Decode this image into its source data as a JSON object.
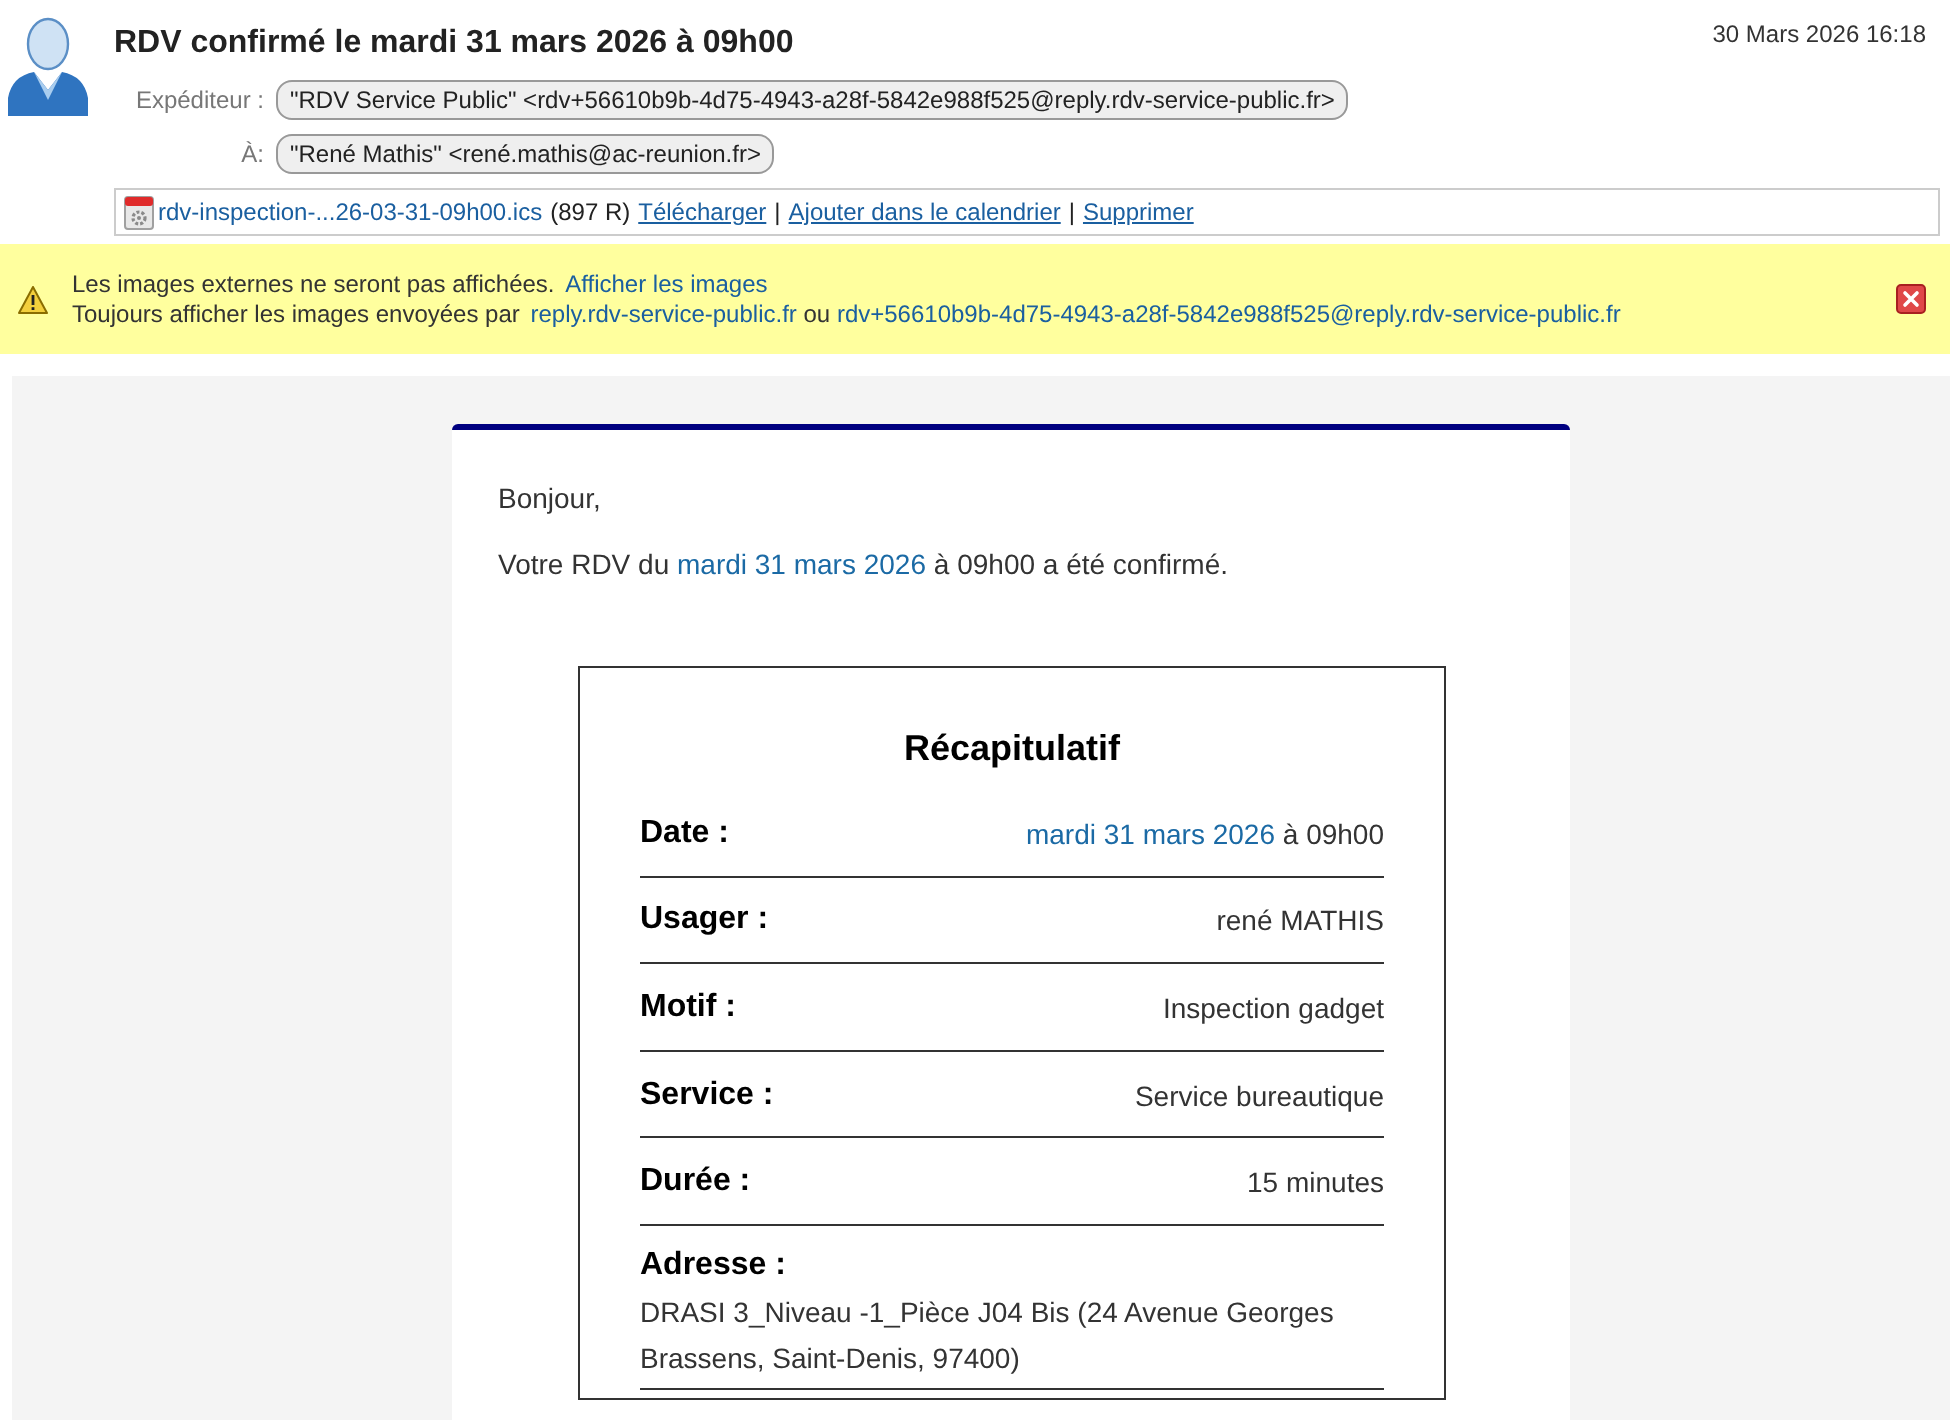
{
  "message": {
    "subject": "RDV confirmé le mardi 31 mars 2026 à 09h00",
    "date": "30 Mars 2026 16:18",
    "from": {
      "label": "Expéditeur :",
      "value": "\"RDV Service Public\" <rdv+56610b9b-4d75-4943-a28f-5842e988f525@reply.rdv-service-public.fr>"
    },
    "to": {
      "label": "À:",
      "value": "\"René Mathis\" <rené.mathis@ac-reunion.fr>"
    }
  },
  "attachment": {
    "filename": "rdv-inspection-...26-03-31-09h00.ics",
    "size": "(897 R)",
    "separator": "|",
    "actions": [
      "Télécharger",
      "Ajouter dans le calendrier",
      "Supprimer"
    ]
  },
  "notice": {
    "text": "Les images externes ne seront pas affichées.",
    "show_link": "Afficher les images",
    "always_text": "Toujours afficher les images envoyées par",
    "senders": [
      "reply.rdv-service-public.fr",
      "rdv+56610b9b-4d75-4943-a28f-5842e988f525@reply.rdv-service-public.fr"
    ],
    "conjunction": "ou"
  },
  "email_body": {
    "greeting": "Bonjour,",
    "confirmation": {
      "before": "Votre RDV du",
      "link": "mardi 31 mars 2026",
      "after": "à 09h00 a été confirmé."
    },
    "summary": {
      "title": "Récapitulatif",
      "rows": [
        {
          "kind": "inline",
          "label": "Date :",
          "link": "mardi 31 mars 2026",
          "value": "à 09h00"
        },
        {
          "kind": "inline",
          "label": "Usager :",
          "value": "rené MATHIS"
        },
        {
          "kind": "inline",
          "label": "Motif :",
          "value": "Inspection gadget"
        },
        {
          "kind": "inline",
          "label": "Service :",
          "value": "Service bureautique"
        },
        {
          "kind": "inline",
          "label": "Durée :",
          "value": "15 minutes"
        },
        {
          "kind": "stacked",
          "label": "Adresse :",
          "value": "DRASI 3_Niveau -1_Pièce J04 Bis (24 Avenue Georges Brassens, Saint-Denis, 97400)"
        }
      ]
    }
  }
}
